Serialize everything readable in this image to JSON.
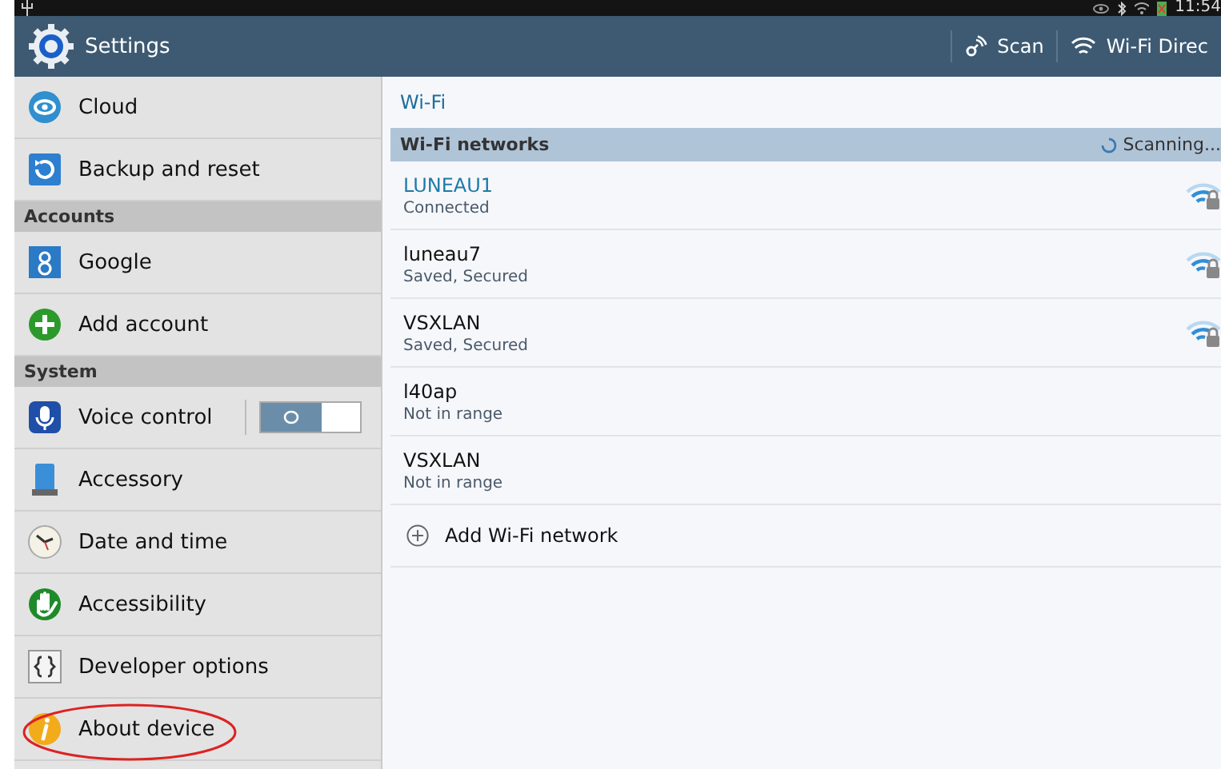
{
  "status_bar": {
    "time": "11:54"
  },
  "action_bar": {
    "title": "Settings",
    "actions": [
      {
        "label": "Scan"
      },
      {
        "label": "Wi-Fi Direc"
      }
    ]
  },
  "sidebar": {
    "items": [
      {
        "kind": "item",
        "label": "Cloud",
        "circled": false
      },
      {
        "kind": "item",
        "label": "Backup and reset",
        "circled": false
      },
      {
        "kind": "header",
        "label": "Accounts"
      },
      {
        "kind": "item",
        "label": "Google",
        "circled": false
      },
      {
        "kind": "item",
        "label": "Add account",
        "circled": false
      },
      {
        "kind": "header",
        "label": "System"
      },
      {
        "kind": "toggle",
        "label": "Voice control",
        "on": false,
        "circled": false
      },
      {
        "kind": "item",
        "label": "Accessory",
        "circled": false
      },
      {
        "kind": "item",
        "label": "Date and time",
        "circled": false
      },
      {
        "kind": "item",
        "label": "Accessibility",
        "circled": false
      },
      {
        "kind": "item",
        "label": "Developer options",
        "circled": false
      },
      {
        "kind": "item",
        "label": "About device",
        "circled": true
      }
    ]
  },
  "content": {
    "title": "Wi-Fi",
    "section": {
      "label": "Wi-Fi networks",
      "status": "Scanning..."
    },
    "networks": [
      {
        "name": "LUNEAU1",
        "status": "Connected",
        "connected": true,
        "in_range": true
      },
      {
        "name": "luneau7",
        "status": "Saved, Secured",
        "connected": false,
        "in_range": true
      },
      {
        "name": "VSXLAN",
        "status": "Saved, Secured",
        "connected": false,
        "in_range": true
      },
      {
        "name": "l40ap",
        "status": "Not in range",
        "connected": false,
        "in_range": false
      },
      {
        "name": "VSXLAN",
        "status": "Not in range",
        "connected": false,
        "in_range": false
      }
    ],
    "add_label": "Add Wi-Fi network"
  }
}
